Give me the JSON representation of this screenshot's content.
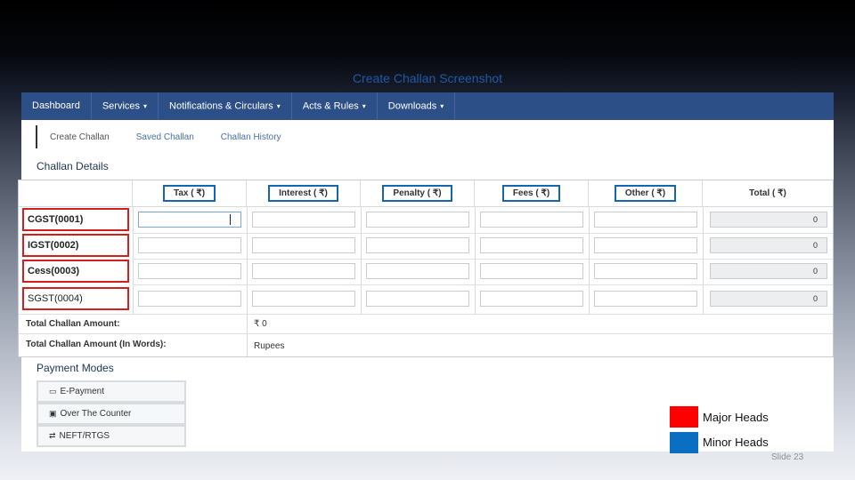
{
  "slide": {
    "title": "Create Challan Screenshot",
    "number": "Slide 23"
  },
  "navbar": {
    "items": [
      {
        "label": "Dashboard",
        "dropdown": false
      },
      {
        "label": "Services",
        "dropdown": true
      },
      {
        "label": "Notifications & Circulars",
        "dropdown": true
      },
      {
        "label": "Acts & Rules",
        "dropdown": true
      },
      {
        "label": "Downloads",
        "dropdown": true
      }
    ],
    "caret_glyph": "▾"
  },
  "subtabs": [
    "Create Challan",
    "Saved Challan",
    "Challan History"
  ],
  "challan_details": {
    "heading": "Challan Details",
    "columns": [
      "Tax ( ₹)",
      "Interest ( ₹)",
      "Penalty ( ₹)",
      "Fees ( ₹)",
      "Other ( ₹)",
      "Total ( ₹)"
    ],
    "rows": [
      {
        "label": "CGST(0001)",
        "total": "0"
      },
      {
        "label": "IGST(0002)",
        "total": "0"
      },
      {
        "label": "Cess(0003)",
        "total": "0"
      },
      {
        "label": "SGST(0004)",
        "total": "0"
      }
    ],
    "total_amount_label": "Total Challan Amount:",
    "total_amount_value": "₹ 0",
    "total_words_label": "Total Challan Amount (In Words):",
    "total_words_value": "Rupees"
  },
  "payment_modes": {
    "heading": "Payment Modes",
    "options": [
      {
        "label": "E-Payment",
        "icon": "card-icon"
      },
      {
        "label": "Over The Counter",
        "icon": "cash-icon"
      },
      {
        "label": "NEFT/RTGS",
        "icon": "bank-transfer-icon"
      }
    ]
  },
  "legend": [
    {
      "label": "Major Heads",
      "color": "#ff0000"
    },
    {
      "label": "Minor Heads",
      "color": "#0a6fc2"
    }
  ],
  "colors": {
    "navbar": "#2c4f87",
    "major_outline": "#d21f1f",
    "minor_outline": "#1565b0"
  }
}
